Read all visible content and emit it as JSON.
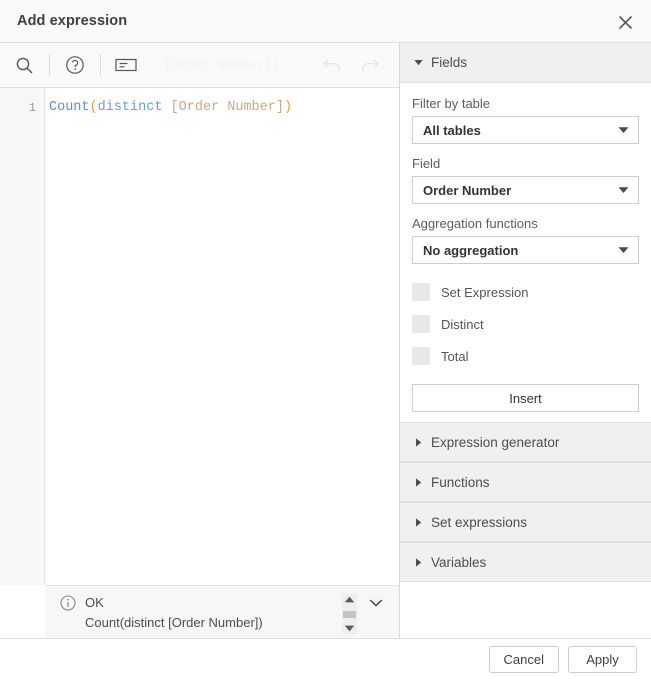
{
  "dialog": {
    "title": "Add expression",
    "close_icon": "close-icon"
  },
  "toolbar": {
    "search_icon": "search-icon",
    "help_icon": "help-circle-icon",
    "snippet_icon": "snippet-icon",
    "undo_icon": "undo-icon",
    "redo_icon": "redo-icon",
    "ghost_text": "[Order Number])"
  },
  "editor": {
    "line_number": "1",
    "tokens": [
      {
        "text": "Count",
        "type": "fn"
      },
      {
        "text": "(",
        "type": "paren"
      },
      {
        "text": "distinct",
        "type": "kw"
      },
      {
        "text": " ",
        "type": "plain"
      },
      {
        "text": "[Order Number]",
        "type": "field"
      },
      {
        "text": ")",
        "type": "paren"
      }
    ]
  },
  "status": {
    "info_icon": "info-circle-icon",
    "state": "OK",
    "expression": "Count(distinct [Order Number])",
    "scroll_up_icon": "triangle-up-icon",
    "scroll_down_icon": "triangle-down-icon",
    "collapse_icon": "chevron-down-icon"
  },
  "fields_panel": {
    "header": {
      "label": "Fields",
      "caret_icon": "caret-down-icon",
      "expanded": true
    },
    "filter_by_table": {
      "label": "Filter by table",
      "value": "All tables",
      "caret_icon": "caret-down-icon"
    },
    "field": {
      "label": "Field",
      "value": "Order Number",
      "caret_icon": "caret-down-icon"
    },
    "aggregation_functions": {
      "label": "Aggregation functions",
      "value": "No aggregation",
      "caret_icon": "caret-down-icon"
    },
    "checkboxes": [
      {
        "label": "Set Expression",
        "checked": false
      },
      {
        "label": "Distinct",
        "checked": false
      },
      {
        "label": "Total",
        "checked": false
      }
    ],
    "insert_label": "Insert"
  },
  "accordions": [
    {
      "label": "Expression generator",
      "caret_icon": "caret-right-icon"
    },
    {
      "label": "Functions",
      "caret_icon": "caret-right-icon"
    },
    {
      "label": "Set expressions",
      "caret_icon": "caret-right-icon"
    },
    {
      "label": "Variables",
      "caret_icon": "caret-right-icon"
    }
  ],
  "footer": {
    "cancel_label": "Cancel",
    "apply_label": "Apply"
  },
  "colors": {
    "token_function": "#5b8dd6",
    "token_keyword": "#6b9bdb",
    "token_paren": "#e3a13c",
    "token_field": "#cba882",
    "panel_header_bg": "#f0f0f0",
    "dialog_border": "#e0e0e0"
  }
}
